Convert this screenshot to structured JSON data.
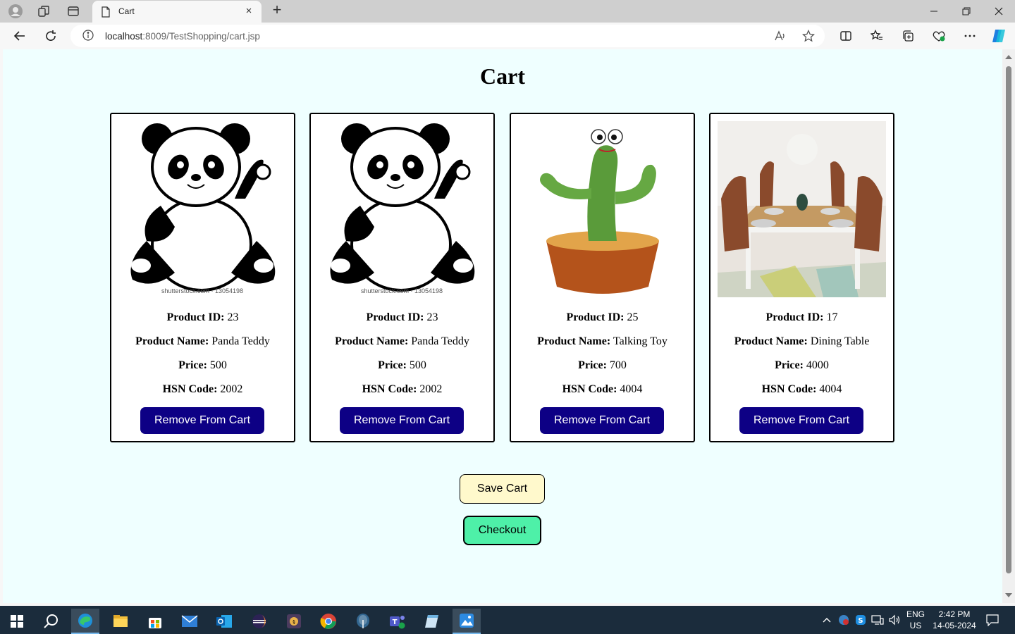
{
  "browser": {
    "tab_title": "Cart",
    "tab_close": "×",
    "new_tab": "+",
    "url_host": "localhost",
    "url_rest": ":8009/TestShopping/cart.jsp"
  },
  "page": {
    "title": "Cart"
  },
  "labels": {
    "product_id": "Product ID:",
    "product_name": "Product Name:",
    "price": "Price:",
    "hsn_code": "HSN Code:"
  },
  "products": [
    {
      "id": "23",
      "name": "Panda Teddy",
      "price": "500",
      "hsn": "2002",
      "image": "panda-teddy-image",
      "watermark": "shutterstock.com · 13054198",
      "remove_label": "Remove From Cart"
    },
    {
      "id": "23",
      "name": "Panda Teddy",
      "price": "500",
      "hsn": "2002",
      "image": "panda-teddy-image",
      "watermark": "shutterstock.com · 13054198",
      "remove_label": "Remove From Cart"
    },
    {
      "id": "25",
      "name": "Talking Toy",
      "price": "700",
      "hsn": "4004",
      "image": "cactus-toy-image",
      "remove_label": "Remove From Cart"
    },
    {
      "id": "17",
      "name": "Dining Table",
      "price": "4000",
      "hsn": "4004",
      "image": "dining-table-image",
      "remove_label": "Remove From Cart"
    }
  ],
  "actions": {
    "save_label": "Save Cart",
    "checkout_label": "Checkout"
  },
  "taskbar": {
    "lang_top": "ENG",
    "lang_bottom": "US",
    "time": "2:42 PM",
    "date": "14-05-2024"
  },
  "colors": {
    "page_bg": "#efffff",
    "remove_button": "#0d0085",
    "save_button": "#fff9cc",
    "checkout_button": "#4ef0a8",
    "taskbar": "#1b2c3c"
  }
}
